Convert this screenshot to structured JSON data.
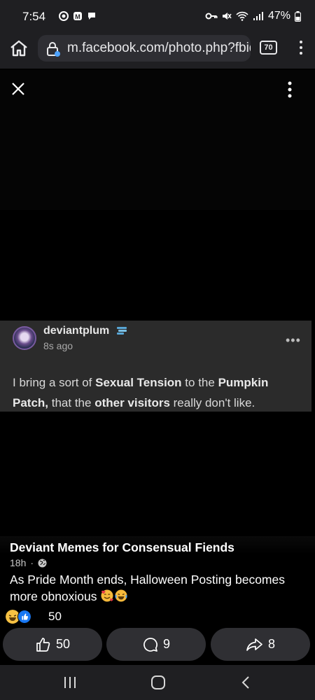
{
  "status": {
    "time": "7:54",
    "battery": "47%"
  },
  "browser": {
    "url": "m.facebook.com/photo.php?fbid",
    "tab_count": "70"
  },
  "tumblr_post": {
    "author": "deviantplum",
    "time": "8s ago",
    "more": "•••",
    "text_parts": {
      "p1": "I bring a sort of ",
      "b1": "Sexual Tension",
      "p2": " to the ",
      "b2": "Pumpkin Patch,",
      "p3": " that the ",
      "b3": "other visitors",
      "p4": " really don't like."
    }
  },
  "facebook": {
    "page_name": "Deviant Memes for Consensual Fiends",
    "post_age": "18h",
    "meta_separator": "·",
    "caption": "As Pride Month ends, Halloween Posting becomes more obnoxious",
    "reaction_count": "50",
    "actions": {
      "like_count": "50",
      "comment_count": "9",
      "share_count": "8"
    }
  },
  "colors": {
    "background": "#000000",
    "system_bar": "#1f1f22",
    "card": "#2b2b2b",
    "button": "#2f2f33",
    "like_blue": "#1877f2"
  }
}
